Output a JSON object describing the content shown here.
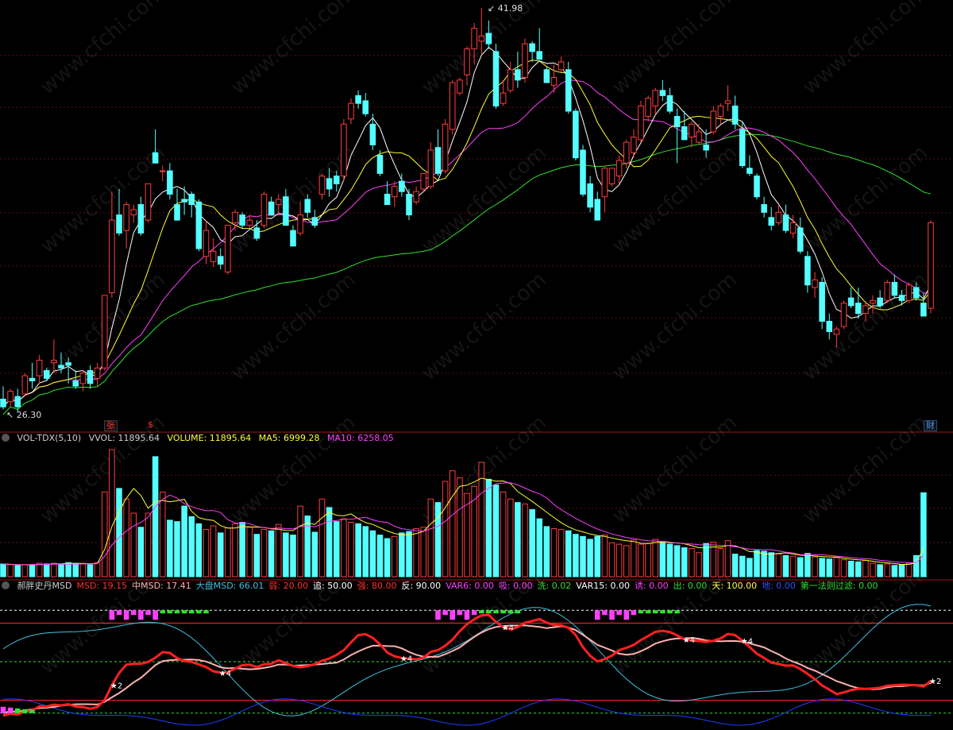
{
  "price": {
    "high_label": "41.98",
    "low_label": "26.30",
    "high": 41.98,
    "low": 26.3
  },
  "markers": {
    "zhang": "张",
    "dollar": "$",
    "cai": "财"
  },
  "watermark": "www.cfchi.com",
  "vol_header": {
    "name": "VOL-TDX(5,10)",
    "vvol": "VVOL: 11895.64",
    "volume": "VOLUME: 11895.64",
    "ma5": "MA5: 6999.28",
    "ma10": "MA10: 6258.05"
  },
  "msd_header": [
    {
      "text": "郝胖史丹MSD",
      "color": "#d0d0d0"
    },
    {
      "text": "MSD: 19.15",
      "color": "#ff3030"
    },
    {
      "text": "中MSD: 17.41",
      "color": "#ffb0b0"
    },
    {
      "text": "大盘MSD: 66.01",
      "color": "#40c0e0"
    },
    {
      "text": "弱: 20.00",
      "color": "#ff3030"
    },
    {
      "text": "追: 50.00",
      "color": "#ffffff"
    },
    {
      "text": "强: 80.00",
      "color": "#ff3030"
    },
    {
      "text": "反: 90.00",
      "color": "#ffffff"
    },
    {
      "text": "VAR6: 0.00",
      "color": "#ff40ff"
    },
    {
      "text": "吸: 0.00",
      "color": "#ff40ff"
    },
    {
      "text": "洗: 0.02",
      "color": "#30e030"
    },
    {
      "text": "VAR15: 0.00",
      "color": "#ffffff"
    },
    {
      "text": "诱: 0.00",
      "color": "#ff40ff"
    },
    {
      "text": "出: 0.00",
      "color": "#30e030"
    },
    {
      "text": "天: 100.00",
      "color": "#ffff40"
    },
    {
      "text": "地: 0.00",
      "color": "#3050ff"
    },
    {
      "text": "第一法则过滤: 0.00",
      "color": "#30e030"
    }
  ],
  "colors": {
    "up": "#ff3c3c",
    "down": "#54ffff",
    "ma5": "#ffffff",
    "ma10": "#ffff30",
    "ma20": "#ff40ff",
    "ma60": "#30e030",
    "vol_ma5": "#ffff30",
    "vol_ma10": "#ff40ff",
    "msd": "#ff2020",
    "mid_msd": "#ffb0b0",
    "market_msd": "#40c0e0",
    "low_line": "#2040ff"
  },
  "chart_data": {
    "type": "candlestick",
    "candles": [
      [
        26.9,
        27.4,
        26.5,
        26.6
      ],
      [
        26.8,
        27.3,
        26.6,
        27.2
      ],
      [
        27.0,
        27.3,
        26.4,
        26.6
      ],
      [
        27.1,
        27.9,
        27.0,
        27.8
      ],
      [
        27.7,
        28.3,
        27.3,
        27.6
      ],
      [
        27.8,
        28.6,
        27.5,
        28.4
      ],
      [
        28.0,
        28.1,
        27.6,
        27.7
      ],
      [
        28.3,
        29.2,
        27.9,
        28.4
      ],
      [
        28.2,
        28.7,
        27.9,
        28.1
      ],
      [
        28.3,
        28.5,
        27.5,
        28.2
      ],
      [
        27.6,
        28.0,
        27.3,
        27.4
      ],
      [
        27.5,
        28.0,
        27.2,
        27.9
      ],
      [
        28.0,
        28.2,
        27.3,
        27.5
      ],
      [
        27.7,
        28.3,
        27.4,
        28.1
      ],
      [
        28.1,
        30.9,
        28.0,
        30.9
      ],
      [
        31.0,
        34.9,
        30.8,
        33.8
      ],
      [
        34.0,
        35.0,
        33.2,
        33.3
      ],
      [
        33.4,
        34.5,
        32.7,
        34.4
      ],
      [
        34.0,
        34.4,
        33.7,
        34.2
      ],
      [
        34.4,
        34.7,
        33.2,
        33.3
      ],
      [
        33.8,
        35.2,
        33.7,
        35.2
      ],
      [
        36.4,
        37.3,
        36.0,
        36.0
      ],
      [
        35.7,
        35.9,
        35.3,
        35.7
      ],
      [
        35.7,
        36.0,
        34.6,
        34.8
      ],
      [
        34.4,
        35.0,
        33.8,
        33.8
      ],
      [
        34.6,
        35.1,
        34.0,
        34.5
      ],
      [
        34.8,
        34.9,
        33.9,
        34.4
      ],
      [
        34.5,
        34.6,
        32.6,
        32.7
      ],
      [
        32.4,
        33.8,
        32.1,
        33.4
      ],
      [
        32.2,
        33.1,
        32.0,
        32.6
      ],
      [
        32.4,
        32.7,
        31.9,
        32.1
      ],
      [
        31.8,
        33.6,
        31.7,
        33.6
      ],
      [
        33.7,
        34.2,
        33.4,
        34.1
      ],
      [
        34.0,
        34.1,
        33.5,
        33.6
      ],
      [
        33.6,
        34.0,
        33.5,
        33.8
      ],
      [
        33.5,
        33.8,
        33.0,
        33.1
      ],
      [
        33.6,
        34.9,
        33.5,
        34.8
      ],
      [
        34.5,
        34.7,
        34.0,
        34.0
      ],
      [
        34.4,
        34.8,
        34.0,
        34.6
      ],
      [
        34.7,
        35.0,
        33.6,
        33.6
      ],
      [
        33.4,
        33.6,
        32.8,
        32.8
      ],
      [
        33.3,
        34.5,
        33.2,
        34.0
      ],
      [
        34.6,
        34.8,
        33.9,
        34.1
      ],
      [
        33.9,
        34.2,
        33.5,
        33.6
      ],
      [
        34.8,
        35.6,
        34.6,
        35.5
      ],
      [
        35.4,
        35.8,
        34.7,
        35.0
      ],
      [
        35.5,
        35.7,
        34.9,
        35.2
      ],
      [
        35.5,
        37.7,
        35.3,
        37.5
      ],
      [
        37.7,
        38.5,
        37.5,
        38.3
      ],
      [
        38.6,
        38.8,
        38.1,
        38.3
      ],
      [
        38.4,
        38.7,
        37.8,
        37.9
      ],
      [
        37.5,
        37.9,
        36.5,
        36.7
      ],
      [
        36.3,
        36.5,
        35.5,
        35.6
      ],
      [
        34.8,
        35.3,
        34.4,
        34.4
      ],
      [
        34.7,
        35.3,
        34.3,
        35.1
      ],
      [
        35.3,
        35.6,
        34.7,
        34.9
      ],
      [
        34.8,
        35.0,
        33.8,
        34.0
      ],
      [
        34.5,
        35.1,
        34.4,
        34.9
      ],
      [
        35.0,
        35.6,
        34.9,
        35.6
      ],
      [
        35.1,
        36.8,
        35.0,
        36.5
      ],
      [
        36.6,
        37.3,
        35.5,
        35.6
      ],
      [
        35.7,
        37.7,
        35.6,
        37.5
      ],
      [
        37.3,
        39.2,
        37.1,
        39.1
      ],
      [
        38.7,
        39.3,
        38.6,
        39.2
      ],
      [
        39.4,
        40.5,
        39.0,
        40.4
      ],
      [
        40.4,
        41.4,
        39.8,
        41.2
      ],
      [
        40.7,
        41.98,
        40.2,
        40.9
      ],
      [
        41.0,
        41.5,
        40.4,
        40.6
      ],
      [
        40.3,
        40.6,
        38.1,
        38.2
      ],
      [
        38.3,
        39.2,
        38.2,
        38.7
      ],
      [
        38.8,
        39.9,
        38.7,
        39.6
      ],
      [
        39.6,
        40.3,
        38.9,
        39.2
      ],
      [
        39.3,
        40.8,
        39.1,
        40.6
      ],
      [
        40.6,
        40.7,
        39.9,
        40.3
      ],
      [
        40.3,
        41.2,
        40.1,
        40.0
      ],
      [
        39.6,
        39.7,
        39.1,
        39.1
      ],
      [
        39.0,
        39.8,
        38.7,
        39.3
      ],
      [
        39.6,
        40.1,
        39.5,
        39.9
      ],
      [
        39.6,
        39.9,
        37.9,
        38.0
      ],
      [
        38.0,
        38.1,
        36.1,
        36.2
      ],
      [
        36.5,
        36.7,
        34.7,
        34.8
      ],
      [
        35.2,
        35.5,
        34.1,
        34.3
      ],
      [
        34.6,
        34.9,
        33.8,
        33.8
      ],
      [
        34.7,
        35.9,
        34.1,
        35.8
      ],
      [
        35.2,
        35.8,
        35.1,
        35.8
      ],
      [
        35.5,
        36.3,
        35.2,
        36.1
      ],
      [
        36.0,
        36.9,
        35.8,
        36.8
      ],
      [
        36.4,
        37.3,
        36.2,
        37.0
      ],
      [
        36.9,
        38.4,
        36.8,
        38.2
      ],
      [
        37.8,
        38.6,
        37.6,
        38.5
      ],
      [
        38.2,
        38.9,
        37.9,
        38.8
      ],
      [
        38.8,
        39.2,
        38.4,
        38.6
      ],
      [
        38.6,
        38.9,
        37.9,
        38.0
      ],
      [
        37.8,
        38.1,
        36.0,
        37.4
      ],
      [
        37.4,
        38.0,
        36.9,
        36.9
      ],
      [
        37.0,
        37.6,
        36.6,
        37.5
      ],
      [
        36.8,
        37.5,
        36.7,
        37.2
      ],
      [
        36.7,
        37.3,
        36.2,
        36.5
      ],
      [
        37.2,
        38.2,
        37.1,
        38.0
      ],
      [
        37.8,
        38.3,
        37.5,
        38.2
      ],
      [
        38.3,
        39.0,
        38.0,
        38.4
      ],
      [
        38.2,
        38.6,
        37.3,
        37.5
      ],
      [
        37.3,
        37.6,
        35.8,
        35.9
      ],
      [
        35.8,
        36.3,
        35.5,
        35.6
      ],
      [
        35.5,
        35.6,
        34.6,
        34.7
      ],
      [
        34.4,
        34.7,
        33.9,
        34.1
      ],
      [
        33.9,
        34.3,
        33.4,
        33.6
      ],
      [
        33.7,
        34.4,
        33.6,
        34.1
      ],
      [
        34.0,
        34.4,
        33.3,
        33.4
      ],
      [
        33.3,
        34.0,
        33.1,
        33.7
      ],
      [
        33.5,
        33.9,
        32.5,
        32.6
      ],
      [
        32.4,
        32.6,
        31.0,
        31.3
      ],
      [
        31.2,
        31.8,
        30.8,
        31.5
      ],
      [
        31.4,
        31.6,
        29.6,
        29.9
      ],
      [
        29.9,
        30.2,
        29.2,
        29.5
      ],
      [
        29.4,
        29.7,
        28.9,
        29.6
      ],
      [
        29.7,
        30.7,
        29.6,
        30.6
      ],
      [
        30.8,
        31.2,
        30.4,
        30.5
      ],
      [
        30.6,
        31.2,
        30.0,
        30.2
      ],
      [
        30.2,
        30.6,
        29.9,
        30.5
      ],
      [
        30.6,
        30.9,
        30.2,
        30.7
      ],
      [
        30.8,
        31.1,
        30.4,
        30.5
      ],
      [
        30.7,
        31.5,
        30.6,
        31.4
      ],
      [
        31.4,
        31.7,
        30.8,
        30.9
      ],
      [
        30.9,
        31.1,
        30.5,
        30.7
      ],
      [
        30.7,
        31.4,
        30.6,
        31.3
      ],
      [
        31.2,
        31.4,
        30.7,
        30.8
      ],
      [
        30.6,
        31.0,
        30.1,
        30.1
      ],
      [
        30.4,
        33.8,
        30.2,
        33.7
      ]
    ],
    "volume": [
      1800,
      1700,
      1600,
      1700,
      1700,
      1900,
      1800,
      1900,
      1800,
      2000,
      1900,
      1800,
      1700,
      2000,
      12000,
      18000,
      12500,
      11000,
      9000,
      7000,
      9000,
      17000,
      12000,
      8000,
      7800,
      10000,
      8500,
      7500,
      6700,
      7200,
      6200,
      6900,
      7500,
      7700,
      7000,
      6000,
      6700,
      6500,
      7400,
      6200,
      5900,
      10000,
      8600,
      6300,
      11000,
      9800,
      7800,
      8200,
      7700,
      7500,
      7100,
      6500,
      5900,
      5400,
      5700,
      6200,
      6400,
      6800,
      7000,
      11000,
      10500,
      13500,
      15000,
      14000,
      11800,
      12800,
      16200,
      13800,
      13000,
      12000,
      11000,
      10500,
      10300,
      9500,
      8200,
      7100,
      6800,
      6700,
      6500,
      6000,
      5700,
      5300,
      5700,
      5900,
      4800,
      4600,
      4400,
      5200,
      4600,
      4700,
      5300,
      4900,
      4600,
      4400,
      4100,
      4000,
      3400,
      4700,
      4900,
      4000,
      5100,
      3200,
      2900,
      2600,
      3700,
      3600,
      3400,
      3200,
      3000,
      2900,
      2700,
      3300,
      2800,
      2600,
      2500,
      2700,
      2400,
      2200,
      2100,
      2300,
      1900,
      1700,
      1800,
      1600,
      1700,
      1900,
      3000,
      11896
    ],
    "msd": {
      "name": "MSD",
      "last": 19.15
    },
    "mid_msd": {
      "name": "中MSD",
      "last": 17.41
    },
    "market_msd": {
      "name": "大盘MSD",
      "last": 66.01
    },
    "levels": {
      "weak": 20,
      "chase": 50,
      "strong": 80,
      "reverse": 90
    },
    "signals": [
      {
        "index": 20,
        "label": "★2"
      },
      {
        "index": 40,
        "label": "★4"
      },
      {
        "index": 74,
        "label": "★4"
      },
      {
        "index": 92,
        "label": "★4"
      },
      {
        "index": 126,
        "label": "★4"
      },
      {
        "index": 136,
        "label": "★4"
      },
      {
        "index": 171,
        "label": "★2"
      }
    ]
  }
}
